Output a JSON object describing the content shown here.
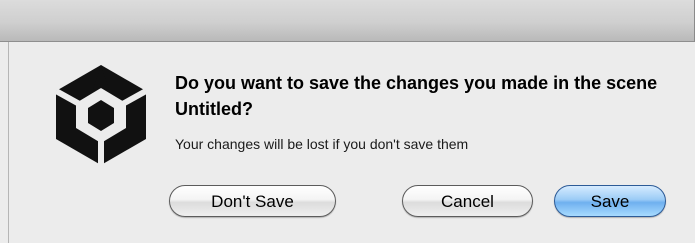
{
  "dialog": {
    "title": "Do you want to save the changes you made in the scene Untitled?",
    "message": "Your changes will be lost if you don't save them",
    "icon": "unity-logo-icon"
  },
  "buttons": {
    "dont_save_label": "Don't Save",
    "cancel_label": "Cancel",
    "save_label": "Save"
  },
  "colors": {
    "default_button": "#7fbdf5",
    "dialog_background": "#ececec"
  }
}
